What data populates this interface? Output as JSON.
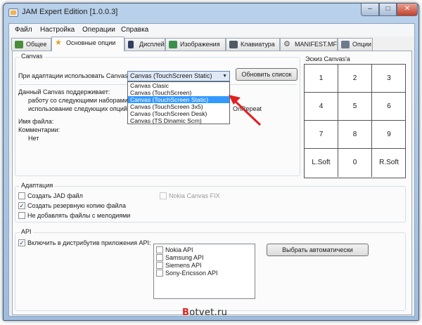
{
  "window": {
    "title": "JAM Expert Edition [1.0.0.3]"
  },
  "title_buttons": {
    "minimize": "–",
    "maximize": "□",
    "close": "✕"
  },
  "menu": [
    "Файл",
    "Настройка",
    "Операции",
    "Справка"
  ],
  "tabs": [
    {
      "label": "Общее",
      "icon": "folder-icon"
    },
    {
      "label": "Основные опции",
      "icon": "star-icon"
    },
    {
      "label": "Дисплей",
      "icon": "phone-icon"
    },
    {
      "label": "Изображения",
      "icon": "image-icon"
    },
    {
      "label": "Клавиатура",
      "icon": "keyboard-icon"
    },
    {
      "label": "MANIFEST.MF",
      "icon": "gear-icon"
    },
    {
      "label": "Опции",
      "icon": "options-icon"
    }
  ],
  "canvas": {
    "group_title": "Canvas",
    "adapt_label": "При адаптации использовать Canvas:",
    "combo_value": "Canvas (TouchScreen Static)",
    "refresh_button": "Обновить список",
    "dropdown_options": [
      "Canvas Clasic",
      "Canvas (TouchScreen)",
      "Canvas (TouchScreen Static)",
      "Canvas (TouchScreen 3x5)",
      "Canvas (TouchScreen Desk)",
      "Canvas (TS Dinamic Scrn)"
    ],
    "dropdown_selected_index": 2,
    "supports_label": "Данный Canvas поддерживает:",
    "sets_label": "работу со следующими наборами к",
    "options_label": "использование следующих опций:",
    "options_value": "OnRepeat",
    "filename_label": "Имя файла:",
    "comments_label": "Комментарии:",
    "comments_value": "Нет"
  },
  "sketch": {
    "title": "Эскиз Canvas'a",
    "keys": [
      "1",
      "2",
      "3",
      "4",
      "5",
      "6",
      "7",
      "8",
      "9",
      "L.Soft",
      "0",
      "R.Soft"
    ]
  },
  "adaptation": {
    "group_title": "Адаптация",
    "options": [
      {
        "label": "Создать JAD файл",
        "checked": false
      },
      {
        "label": "Создать резервную копию файла",
        "checked": true
      },
      {
        "label": "Не добавлять файлы с мелодиями",
        "checked": false
      }
    ],
    "nokia_fix": {
      "label": "Nokia Canvas FIX",
      "checked": false,
      "enabled": false
    }
  },
  "api": {
    "group_title": "API",
    "include_label": "Включить в дистрибутив приложения API:",
    "include_checked": true,
    "list": [
      {
        "label": "Nokia API",
        "checked": false
      },
      {
        "label": "Samsung API",
        "checked": false
      },
      {
        "label": "Siemens API",
        "checked": false
      },
      {
        "label": "Sony-Ericsson API",
        "checked": false
      }
    ],
    "auto_button": "Выбрать автоматически"
  },
  "watermark": {
    "first_letter": "B",
    "rest": "otvet.ru"
  },
  "colors": {
    "selection": "#3399ff",
    "arrow": "#e02020",
    "watermark_accent": "#e02020"
  }
}
